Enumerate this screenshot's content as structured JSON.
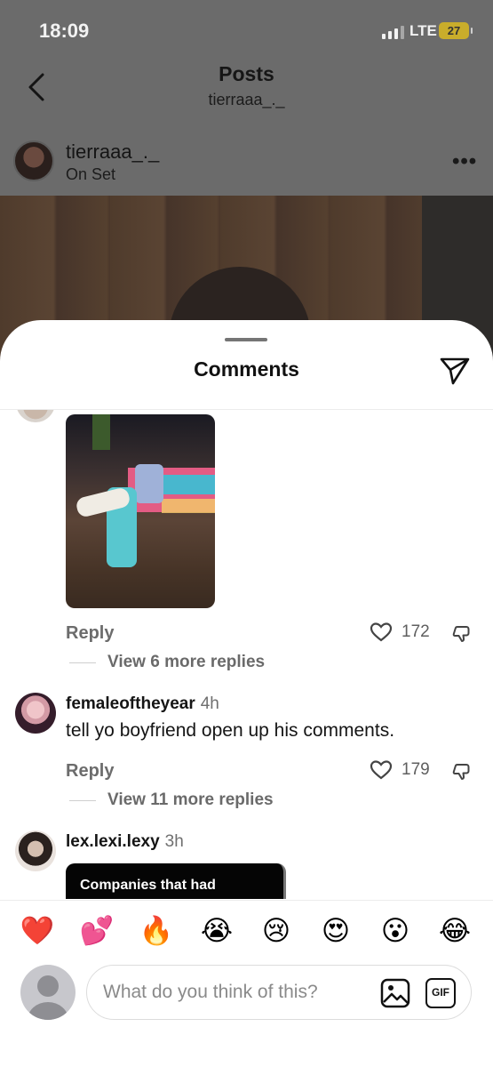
{
  "status_bar": {
    "time": "18:09",
    "network": "LTE",
    "battery": "27"
  },
  "header": {
    "title": "Posts",
    "subtitle": "tierraaa_._"
  },
  "post": {
    "username": "tierraaa_._",
    "location": "On Set"
  },
  "comments_sheet": {
    "title": "Comments",
    "thread_1": {
      "reply_label": "Reply",
      "likes": "172",
      "view_replies": "View 6 more replies"
    },
    "comments": [
      {
        "username": "femaleoftheyear",
        "time": "4h",
        "text": "tell yo boyfriend open up his comments.",
        "reply_label": "Reply",
        "likes": "179",
        "view_replies": "View 11 more replies"
      },
      {
        "username": "lex.lexi.lexy",
        "time": "3h",
        "card_text": "Companies that had"
      }
    ]
  },
  "reactions": [
    "❤️",
    "💕",
    "🔥",
    "😭",
    "😢",
    "😍",
    "😮",
    "😂"
  ],
  "composer": {
    "placeholder": "What do you think of this?",
    "gif_label": "GIF"
  },
  "colors": {
    "heart": "#e0245e",
    "battery": "#c9ad2b"
  }
}
